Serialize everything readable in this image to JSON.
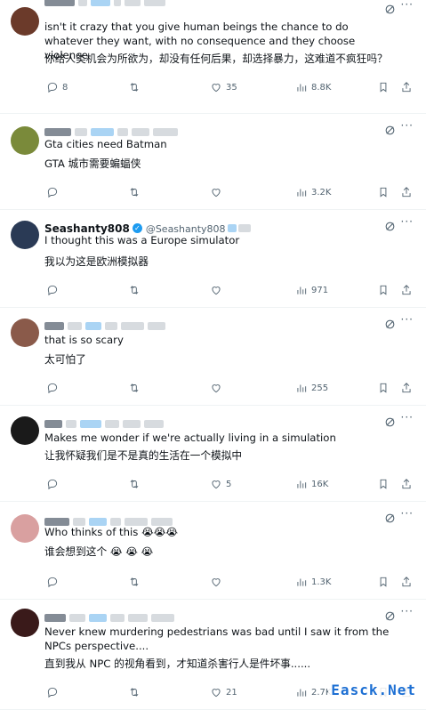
{
  "posts": [
    {
      "name": "",
      "handle": "",
      "text": "isn't it crazy that you give human beings the chance to do whatever they want, with no consequence and they choose violence",
      "translation": "你给人类机会为所欲为，却没有任何后果，却选择暴力，这难道不疯狂吗？",
      "replies": "8",
      "retweets": "",
      "likes": "35",
      "views": "8.8K",
      "avatar_color": "#6b3a2a"
    },
    {
      "name": "",
      "handle": "",
      "text": "Gta cities need Batman",
      "translation": "GTA 城市需要蝙蝠侠",
      "replies": "",
      "retweets": "",
      "likes": "",
      "views": "3.2K",
      "avatar_color": "#7a8a3a"
    },
    {
      "name": "Seashanty808",
      "handle": "@Seashanty808",
      "text": "I thought this was a Europe simulator",
      "translation": "我以为这是欧洲模拟器",
      "replies": "",
      "retweets": "",
      "likes": "",
      "views": "971",
      "avatar_color": "#2a3a55"
    },
    {
      "name": "",
      "handle": "",
      "text": "that is so scary",
      "translation": "太可怕了",
      "replies": "",
      "retweets": "",
      "likes": "",
      "views": "255",
      "avatar_color": "#8a5a4a"
    },
    {
      "name": "",
      "handle": "",
      "text": "Makes me wonder if we're actually living in a simulation",
      "translation": "让我怀疑我们是不是真的生活在一个模拟中",
      "replies": "",
      "retweets": "",
      "likes": "5",
      "views": "16K",
      "avatar_color": "#1a1a1a"
    },
    {
      "name": "",
      "handle": "",
      "text": "Who thinks of this 😭😭😭",
      "translation": "谁会想到这个 😭 😭 😭",
      "replies": "",
      "retweets": "",
      "likes": "",
      "views": "1.3K",
      "avatar_color": "#d9a0a0"
    },
    {
      "name": "",
      "handle": "",
      "text": "Never knew murdering pedestrians was bad until I saw it from the NPCs perspective....",
      "translation": "直到我从 NPC 的视角看到，才知道杀害行人是件坏事......",
      "replies": "",
      "retweets": "",
      "likes": "21",
      "views": "2.7K",
      "avatar_color": "#3a1a1a"
    }
  ],
  "watermark": "Easck.Net",
  "icons": {
    "reply": "reply-icon",
    "retweet": "retweet-icon",
    "like": "heart-icon",
    "views": "views-icon",
    "bookmark": "bookmark-icon",
    "share": "share-icon",
    "grok": "grok-icon",
    "more": "more-icon"
  },
  "colors": {
    "text": "#0f1419",
    "muted": "#536471",
    "verified": "#1d9bf0",
    "divider": "#eff3f4"
  }
}
